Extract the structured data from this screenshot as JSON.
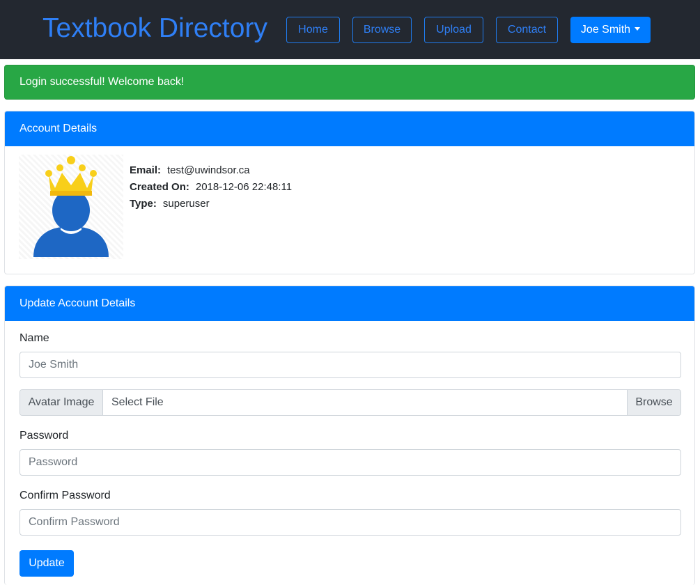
{
  "navbar": {
    "brand": "Textbook Directory",
    "links": [
      "Home",
      "Browse",
      "Upload",
      "Contact"
    ],
    "user_menu": "Joe Smith"
  },
  "alert": {
    "text": "Login successful! Welcome back!",
    "color": "#28a745"
  },
  "account_details": {
    "title": "Account Details",
    "avatar_icon": "superuser-crown-avatar-icon",
    "email_label": "Email:",
    "email": "test@uwindsor.ca",
    "created_label": "Created On:",
    "created": "2018-12-06 22:48:11",
    "type_label": "Type:",
    "type": "superuser"
  },
  "update_form": {
    "title": "Update Account Details",
    "name_label": "Name",
    "name_placeholder": "Joe Smith",
    "avatar_addon": "Avatar Image",
    "file_placeholder": "Select File",
    "browse_label": "Browse",
    "password_label": "Password",
    "password_placeholder": "Password",
    "confirm_label": "Confirm Password",
    "confirm_placeholder": "Confirm Password",
    "submit_label": "Update"
  },
  "colors": {
    "primary": "#007bff",
    "navbar_bg": "#232830",
    "success": "#28a745"
  }
}
